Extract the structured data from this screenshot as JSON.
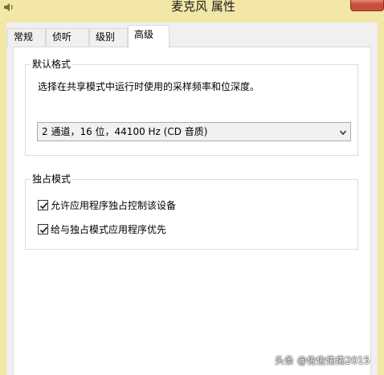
{
  "window": {
    "title": "麦克风 属性",
    "frame_color": "#f3e7a7",
    "close_button_color": "#c7503c"
  },
  "tabs": [
    {
      "label": "常规",
      "active": false
    },
    {
      "label": "侦听",
      "active": false
    },
    {
      "label": "级别",
      "active": false
    },
    {
      "label": "高级",
      "active": true
    }
  ],
  "default_format": {
    "legend": "默认格式",
    "description": "选择在共享模式中运行时使用的采样频率和位深度。",
    "selected_value": "2 通道，16 位，44100 Hz (CD 音质)"
  },
  "exclusive_mode": {
    "legend": "独占模式",
    "options": [
      {
        "label": "允许应用程序独占控制该设备",
        "checked": true
      },
      {
        "label": "给与独占模式应用程序优先",
        "checked": true
      }
    ]
  },
  "watermark": "头条 @佐佐佑佑2015",
  "icons": {
    "app": "speaker-icon",
    "dropdown": "chevron-down-icon",
    "check": "check-icon"
  }
}
